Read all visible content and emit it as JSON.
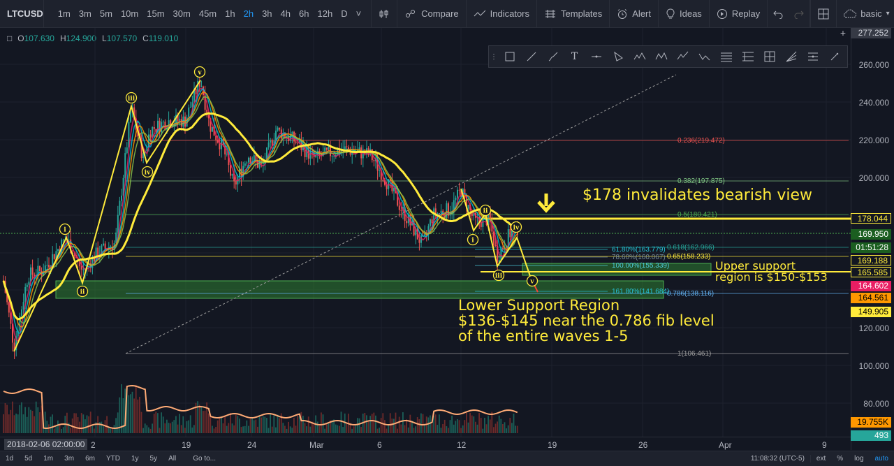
{
  "toolbar": {
    "symbol": "LTCUSD",
    "intervals": [
      "1m",
      "3m",
      "5m",
      "10m",
      "15m",
      "30m",
      "45m",
      "1h",
      "2h",
      "3h",
      "4h",
      "6h",
      "12h",
      "D"
    ],
    "active_interval": "2h",
    "compare_label": "Compare",
    "indicators_label": "Indicators",
    "templates_label": "Templates",
    "alert_label": "Alert",
    "ideas_label": "Ideas",
    "replay_label": "Replay",
    "layout_label": "basic"
  },
  "ohlc": {
    "o_label": "O",
    "o": "107.630",
    "h_label": "H",
    "h": "124.900",
    "l_label": "L",
    "l": "107.570",
    "c_label": "C",
    "c": "119.010"
  },
  "price_axis": {
    "top_label": "277.252",
    "ticks": [
      "260.000",
      "240.000",
      "220.000",
      "200.000",
      "120.000",
      "100.000",
      "80.000"
    ],
    "labels": [
      {
        "text": "178.044",
        "bg": "#131722",
        "fg": "#ffeb3b",
        "border": "#ffeb3b"
      },
      {
        "text": "169.950",
        "bg": "#1b5e20",
        "fg": "#ffffff"
      },
      {
        "text": "01:51:28",
        "bg": "#1b5e20",
        "fg": "#ffffff"
      },
      {
        "text": "169.188",
        "bg": "#131722",
        "fg": "#ffeb3b",
        "border": "#ffeb3b"
      },
      {
        "text": "165.585",
        "bg": "#131722",
        "fg": "#ffeb3b",
        "border": "#ffeb3b"
      },
      {
        "text": "164.602",
        "bg": "#e91e63",
        "fg": "#ffffff"
      },
      {
        "text": "164.561",
        "bg": "#ff9800",
        "fg": "#000000"
      },
      {
        "text": "149.905",
        "bg": "#ffeb3b",
        "fg": "#000000"
      },
      {
        "text": "19.755K",
        "bg": "#ff9800",
        "fg": "#000000"
      },
      {
        "text": "493",
        "bg": "#26a69a",
        "fg": "#ffffff"
      }
    ]
  },
  "time_axis": {
    "current": "2018-02-06 02:00:00",
    "ticks": [
      "2",
      "19",
      "24",
      "Mar",
      "6",
      "12",
      "19",
      "26",
      "Apr",
      "9"
    ]
  },
  "fib_levels": [
    {
      "label": "0.236(219.472)",
      "color": "#ef5350"
    },
    {
      "label": "0.382(197.875)",
      "color": "#81c784"
    },
    {
      "label": "0.5(180.421)",
      "color": "#4caf50"
    },
    {
      "label": "0.618(162.966)",
      "color": "#26a69a"
    },
    {
      "label": "0.65(158.233)",
      "color": "#ffeb3b"
    },
    {
      "label": "0.786(138.116)",
      "color": "#64b5f6"
    },
    {
      "label": "1(106.461)",
      "color": "#9e9e9e"
    },
    {
      "label": "61.80%(163.779)",
      "color": "#26c6da"
    },
    {
      "label": "78.60%(160.067)",
      "color": "#78909c"
    },
    {
      "label": "100.00%(155.339)",
      "color": "#4dd0e1"
    },
    {
      "label": "161.80%(141.684)",
      "color": "#26c6da"
    }
  ],
  "annotations": {
    "invalidate": "$178 invalidates bearish view",
    "upper_support_1": "Upper support",
    "upper_support_2": "region is $150-$153",
    "lower_support_1": "Lower Support Region",
    "lower_support_2": "$136-$145 near the 0.786 fib level",
    "lower_support_3": "of the entire waves 1-5"
  },
  "wave_labels": {
    "i": "i",
    "ii": "ii",
    "iii": "iii",
    "iv": "iv",
    "v": "v"
  },
  "bottom_bar": {
    "ranges": [
      "1d",
      "5d",
      "1m",
      "3m",
      "6m",
      "YTD",
      "1y",
      "5y",
      "All"
    ],
    "goto": "Go to...",
    "time": "11:08:32 (UTC-5)",
    "ext": "ext",
    "pct": "%",
    "log": "log",
    "auto": "auto"
  },
  "colors": {
    "background": "#131722",
    "annotation": "#ffeb3b",
    "bull": "#26a69a",
    "bear": "#ef5350"
  }
}
